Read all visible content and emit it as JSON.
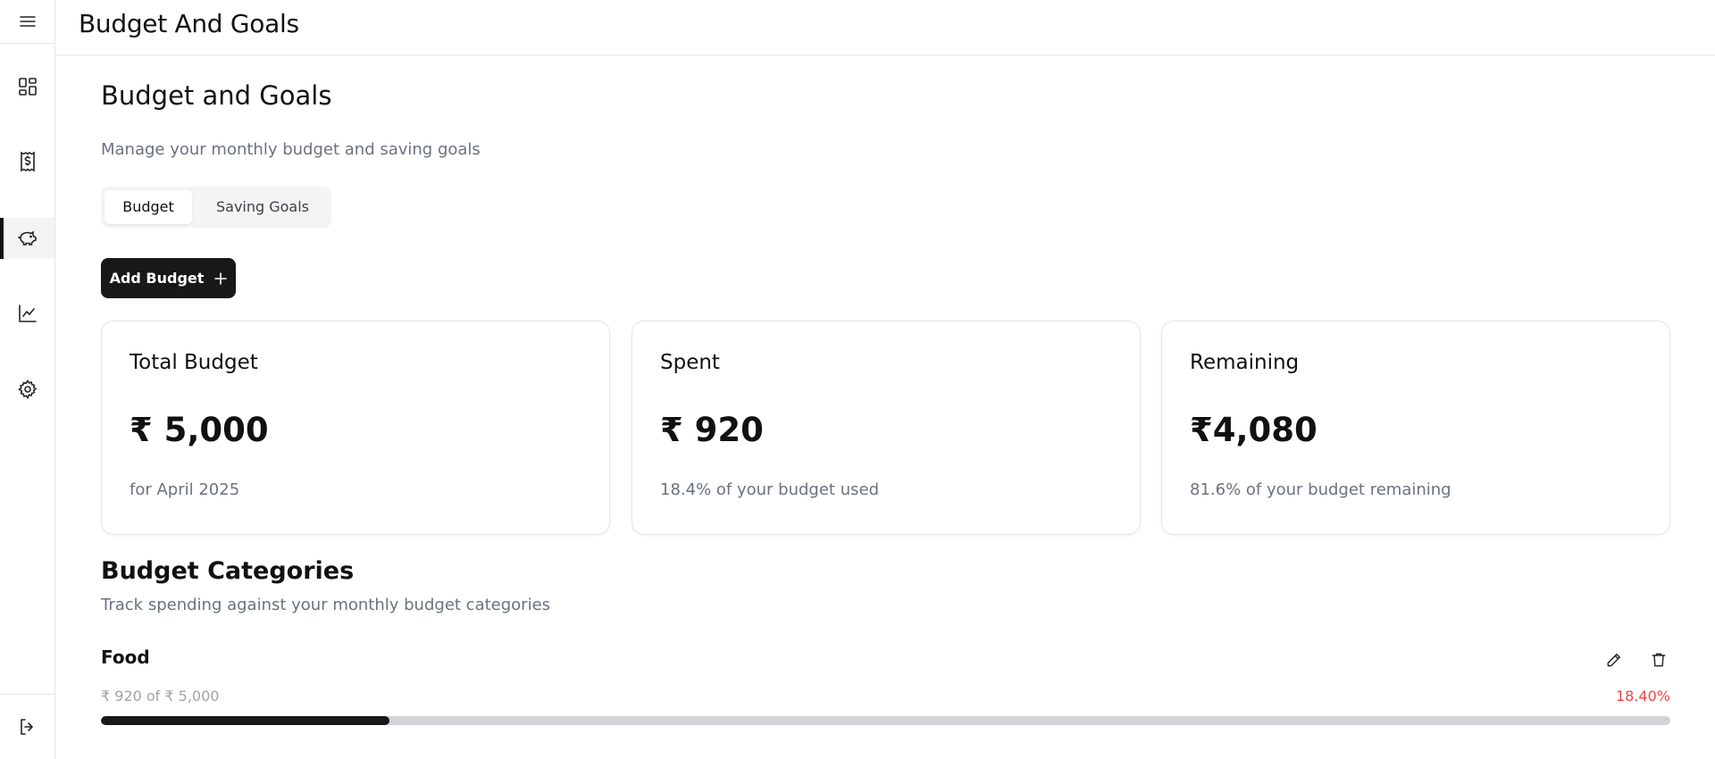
{
  "header": {
    "title": "Budget And Goals"
  },
  "sidebar": {
    "items": [
      {
        "icon": "dashboard-icon"
      },
      {
        "icon": "receipt-dollar-icon"
      },
      {
        "icon": "piggy-bank-icon",
        "active": true
      },
      {
        "icon": "chart-line-icon"
      },
      {
        "icon": "gear-icon"
      }
    ],
    "bottom_icon": "logout-icon",
    "top_icon": "menu-icon"
  },
  "page": {
    "title": "Budget and Goals",
    "subtitle": "Manage your monthly budget and saving goals"
  },
  "tabs": [
    {
      "label": "Budget",
      "active": true
    },
    {
      "label": "Saving Goals",
      "active": false
    }
  ],
  "add_button": {
    "label": "Add Budget"
  },
  "summary_cards": [
    {
      "title": "Total Budget",
      "value": "₹ 5,000",
      "subtitle": "for April 2025"
    },
    {
      "title": "Spent",
      "value": "₹ 920",
      "subtitle": "18.4% of your budget used"
    },
    {
      "title": "Remaining",
      "value": "₹4,080",
      "subtitle": "81.6% of your budget remaining"
    }
  ],
  "categories_section": {
    "title": "Budget Categories",
    "subtitle": "Track spending against your monthly budget categories",
    "items": [
      {
        "name": "Food",
        "amount_text": "₹ 920 of ₹ 5,000",
        "percent_text": "18.40%",
        "progress": 0.184
      }
    ]
  },
  "colors": {
    "accent": "#18181b",
    "muted_text": "#6b7280",
    "danger": "#ef4444",
    "track": "#d4d4d8"
  }
}
